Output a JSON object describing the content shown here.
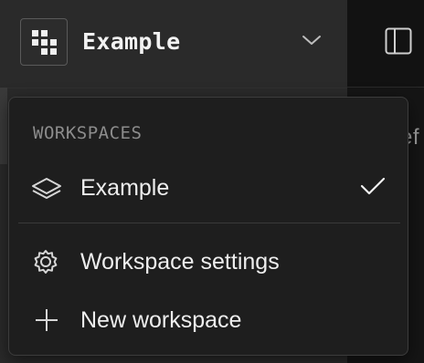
{
  "header": {
    "workspace_name": "Example",
    "logo_icon": "grid-logo-icon",
    "dropdown_icon": "chevron-down-icon",
    "panel_toggle_icon": "sidebar-panel-icon"
  },
  "right_pane": {
    "partial_text": "ef"
  },
  "menu": {
    "heading": "WORKSPACES",
    "workspaces": [
      {
        "label": "Example",
        "icon": "layers-icon",
        "selected": true
      }
    ],
    "actions": [
      {
        "label": "Workspace settings",
        "icon": "gear-icon"
      },
      {
        "label": "New workspace",
        "icon": "plus-icon"
      }
    ]
  },
  "colors": {
    "sidebar_bg": "#2a2a2a",
    "menu_bg": "#1e1e1e",
    "menu_border": "#3c3c3c",
    "text": "#eeeeee",
    "muted_text": "#8c8c8c"
  }
}
